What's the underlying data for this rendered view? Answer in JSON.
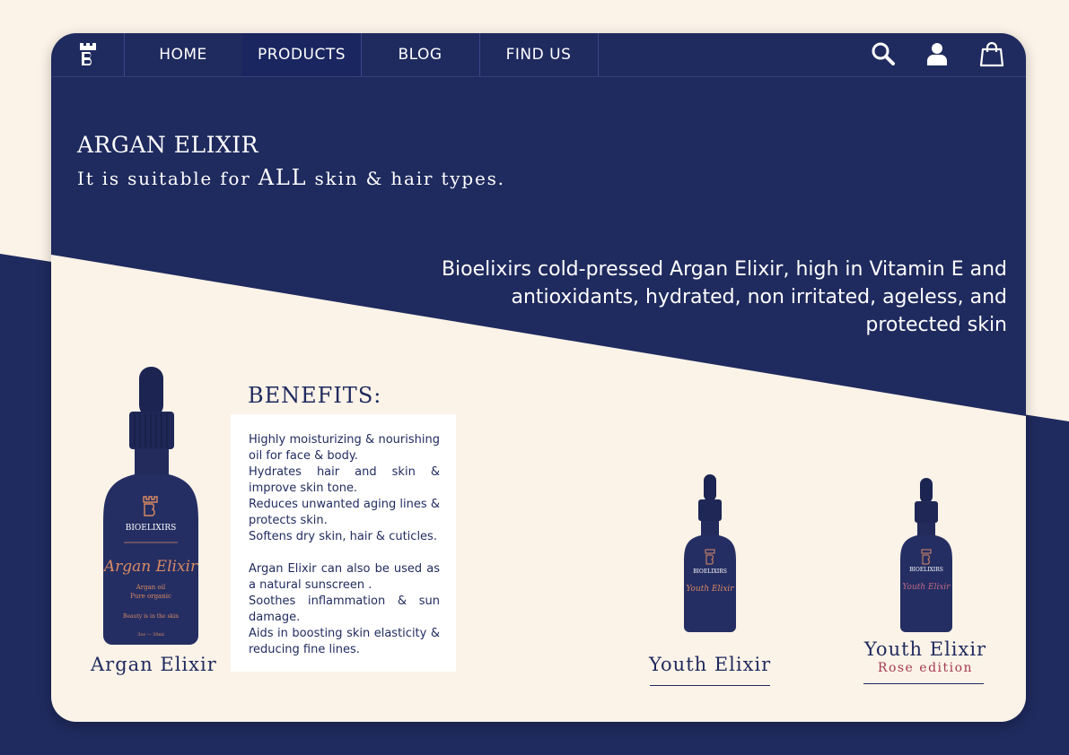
{
  "colors": {
    "navy": "#1f2a5e",
    "cream": "#fbf3e8",
    "rose": "#a43a52",
    "copper": "#d98a63"
  },
  "nav": {
    "logo_icon": "bioelixirs-crest-icon",
    "items": [
      {
        "label": "HOME",
        "active": false
      },
      {
        "label": "PRODUCTS",
        "active": true
      },
      {
        "label": "BLOG",
        "active": false
      },
      {
        "label": "FIND US",
        "active": false
      }
    ],
    "icons": [
      "search-icon",
      "user-icon",
      "shopping-bag-icon"
    ]
  },
  "hero": {
    "title": "ARGAN ELIXIR",
    "subtitle_before": "It is suitable for ",
    "subtitle_emphasis": "ALL",
    "subtitle_after": " skin & hair types.",
    "description": "Bioelixirs cold-pressed Argan Elixir, high in Vitamin E and antioxidants, hydrated, non irritated, ageless, and protected skin"
  },
  "benefits": {
    "title": "BENEFITS:",
    "lines_group1": [
      "Highly moisturizing & nourishing oil for face & body.",
      "Hydrates hair and skin & improve skin tone.",
      "Reduces unwanted aging lines & protects skin.",
      "Softens dry skin, hair & cuticles."
    ],
    "lines_group2": [
      "Argan Elixir can also be used as a natural sunscreen .",
      "Soothes inflammation & sun damage.",
      "Aids in boosting skin elasticity & reducing fine lines."
    ]
  },
  "products": {
    "main": {
      "name": "Argan Elixir",
      "label_brand": "BIOELIXIRS",
      "label_script": "Argan Elixir",
      "label_line1": "Argan oil",
      "label_line2": "Pure organic",
      "label_tagline": "Beauty is in the skin",
      "label_volume": "3oz — 30ml"
    },
    "youth": {
      "name": "Youth Elixir",
      "label_brand": "BIOELIXIRS",
      "label_script": "Youth Elixir"
    },
    "youth_rose": {
      "name": "Youth Elixir",
      "edition": "Rose edition",
      "label_brand": "BIOELIXIRS",
      "label_script": "Youth Elixir"
    }
  }
}
